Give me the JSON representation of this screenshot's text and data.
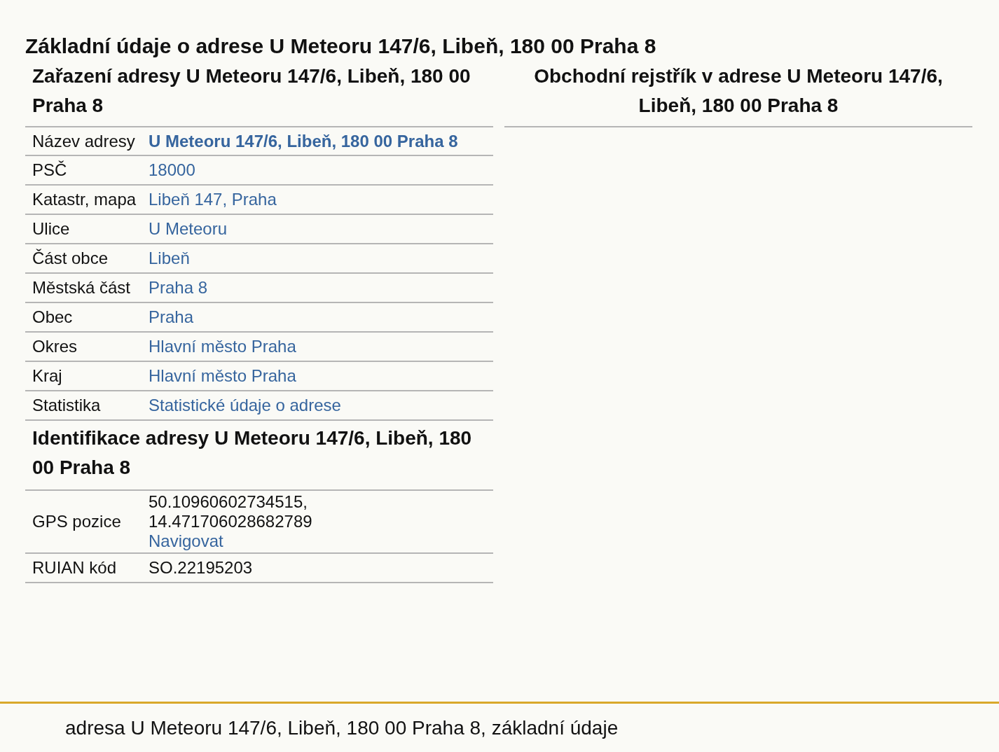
{
  "title": "Základní údaje o adrese U Meteoru 147/6, Libeň, 180 00 Praha 8",
  "classification": {
    "heading": "Zařazení adresy U Meteoru 147/6, Libeň, 180 00 Praha 8",
    "rows": [
      {
        "label": "Název adresy",
        "kind": "bold_link",
        "value": "U Meteoru 147/6, Libeň, 180 00 Praha 8"
      },
      {
        "label": "PSČ",
        "kind": "link",
        "value": "18000"
      },
      {
        "label": "Katastr, mapa",
        "kind": "link",
        "value": "Libeň 147, Praha"
      },
      {
        "label": "Ulice",
        "kind": "link",
        "value": "U Meteoru"
      },
      {
        "label": "Část obce",
        "kind": "link",
        "value": "Libeň"
      },
      {
        "label": "Městská část",
        "kind": "link",
        "value": "Praha 8"
      },
      {
        "label": "Obec",
        "kind": "link",
        "value": "Praha"
      },
      {
        "label": "Okres",
        "kind": "link",
        "value": "Hlavní město Praha"
      },
      {
        "label": "Kraj",
        "kind": "link",
        "value": "Hlavní město Praha"
      },
      {
        "label": "Statistika",
        "kind": "link",
        "value": "Statistické údaje o adrese"
      }
    ]
  },
  "identification": {
    "heading": "Identifikace adresy U Meteoru 147/6, Libeň, 180 00 Praha 8",
    "rows": [
      {
        "label": "GPS pozice",
        "kind": "gps",
        "lines": [
          "50.10960602734515,",
          "14.471706028682789"
        ],
        "link": "Navigovat"
      },
      {
        "label": "RUIAN kód",
        "kind": "text",
        "value": "SO.22195203"
      }
    ]
  },
  "business_register": {
    "heading": "Obchodní rejstřík v adrese U Meteoru 147/6, Libeň, 180 00 Praha 8"
  },
  "footer": "adresa U Meteoru 147/6, Libeň, 180 00 Praha 8, základní údaje"
}
